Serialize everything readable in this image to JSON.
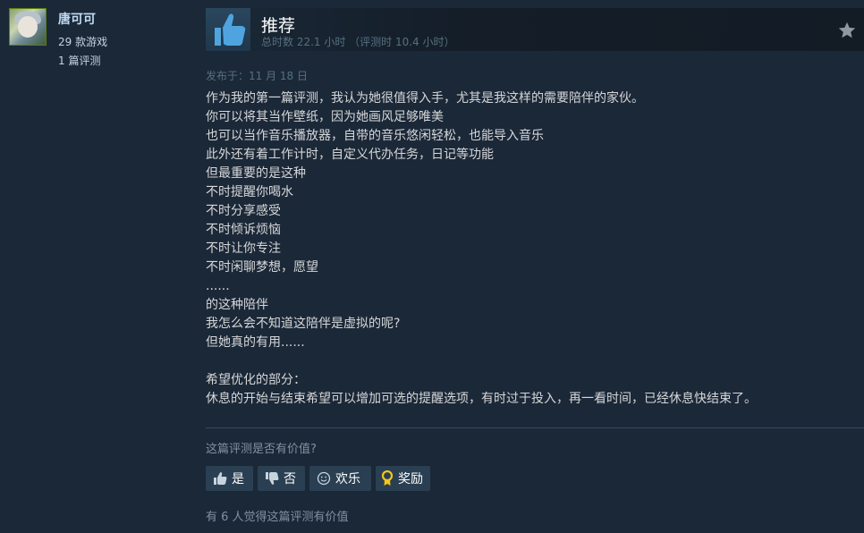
{
  "author": {
    "name": "唐可可",
    "games_owned": "29 款游戏",
    "reviews_count": "1 篇评测"
  },
  "review_header": {
    "verdict": "推荐",
    "hours": "总时数 22.1 小时 （评测时 10.4 小时）",
    "verdict_icon": "thumbs-up-icon",
    "award_icon": "star-icon"
  },
  "posted_date": "发布于：11 月 18 日",
  "review_lines": [
    "作为我的第一篇评测，我认为她很值得入手，尤其是我这样的需要陪伴的家伙。",
    "你可以将其当作壁纸，因为她画风足够唯美",
    "也可以当作音乐播放器，自带的音乐悠闲轻松，也能导入音乐",
    "此外还有着工作计时，自定义代办任务，日记等功能",
    "但最重要的是这种",
    "不时提醒你喝水",
    "不时分享感受",
    "不时倾诉烦恼",
    "不时让你专注",
    "不时闲聊梦想，愿望",
    "......",
    "的这种陪伴",
    "我怎么会不知道这陪伴是虚拟的呢?",
    "但她真的有用......",
    "",
    "希望优化的部分：",
    "休息的开始与结束希望可以增加可选的提醒选项，有时过于投入，再一看时间，已经休息快结束了。"
  ],
  "feedback": {
    "question": "这篇评测是否有价值?",
    "yes_label": "是",
    "no_label": "否",
    "funny_label": "欢乐",
    "award_label": "奖励",
    "helpful_count_text": "有 6 人觉得这篇评测有价值"
  },
  "colors": {
    "background": "#1b2838",
    "author_name": "#c1dbf4",
    "thumb_blue": "#4fa4e0",
    "award_gold": "#f5c518"
  }
}
